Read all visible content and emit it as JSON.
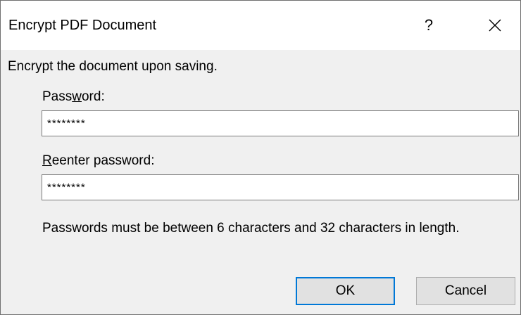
{
  "dialog": {
    "title": "Encrypt PDF Document",
    "help_label": "?",
    "close_icon": "close-x-icon",
    "intro_text": "Encrypt the document upon saving.",
    "password": {
      "label_pre": "Pass",
      "label_accel": "w",
      "label_post": "ord:",
      "value": "********"
    },
    "reenter": {
      "label_accel": "R",
      "label_post": "eenter password:",
      "value": "********"
    },
    "hint_text": "Passwords must be between 6 characters and 32 characters in length.",
    "ok_label": "OK",
    "cancel_label": "Cancel"
  },
  "colors": {
    "title_bg": "#ffffff",
    "body_bg": "#f0f0f0",
    "default_button_border": "#0078d7"
  }
}
